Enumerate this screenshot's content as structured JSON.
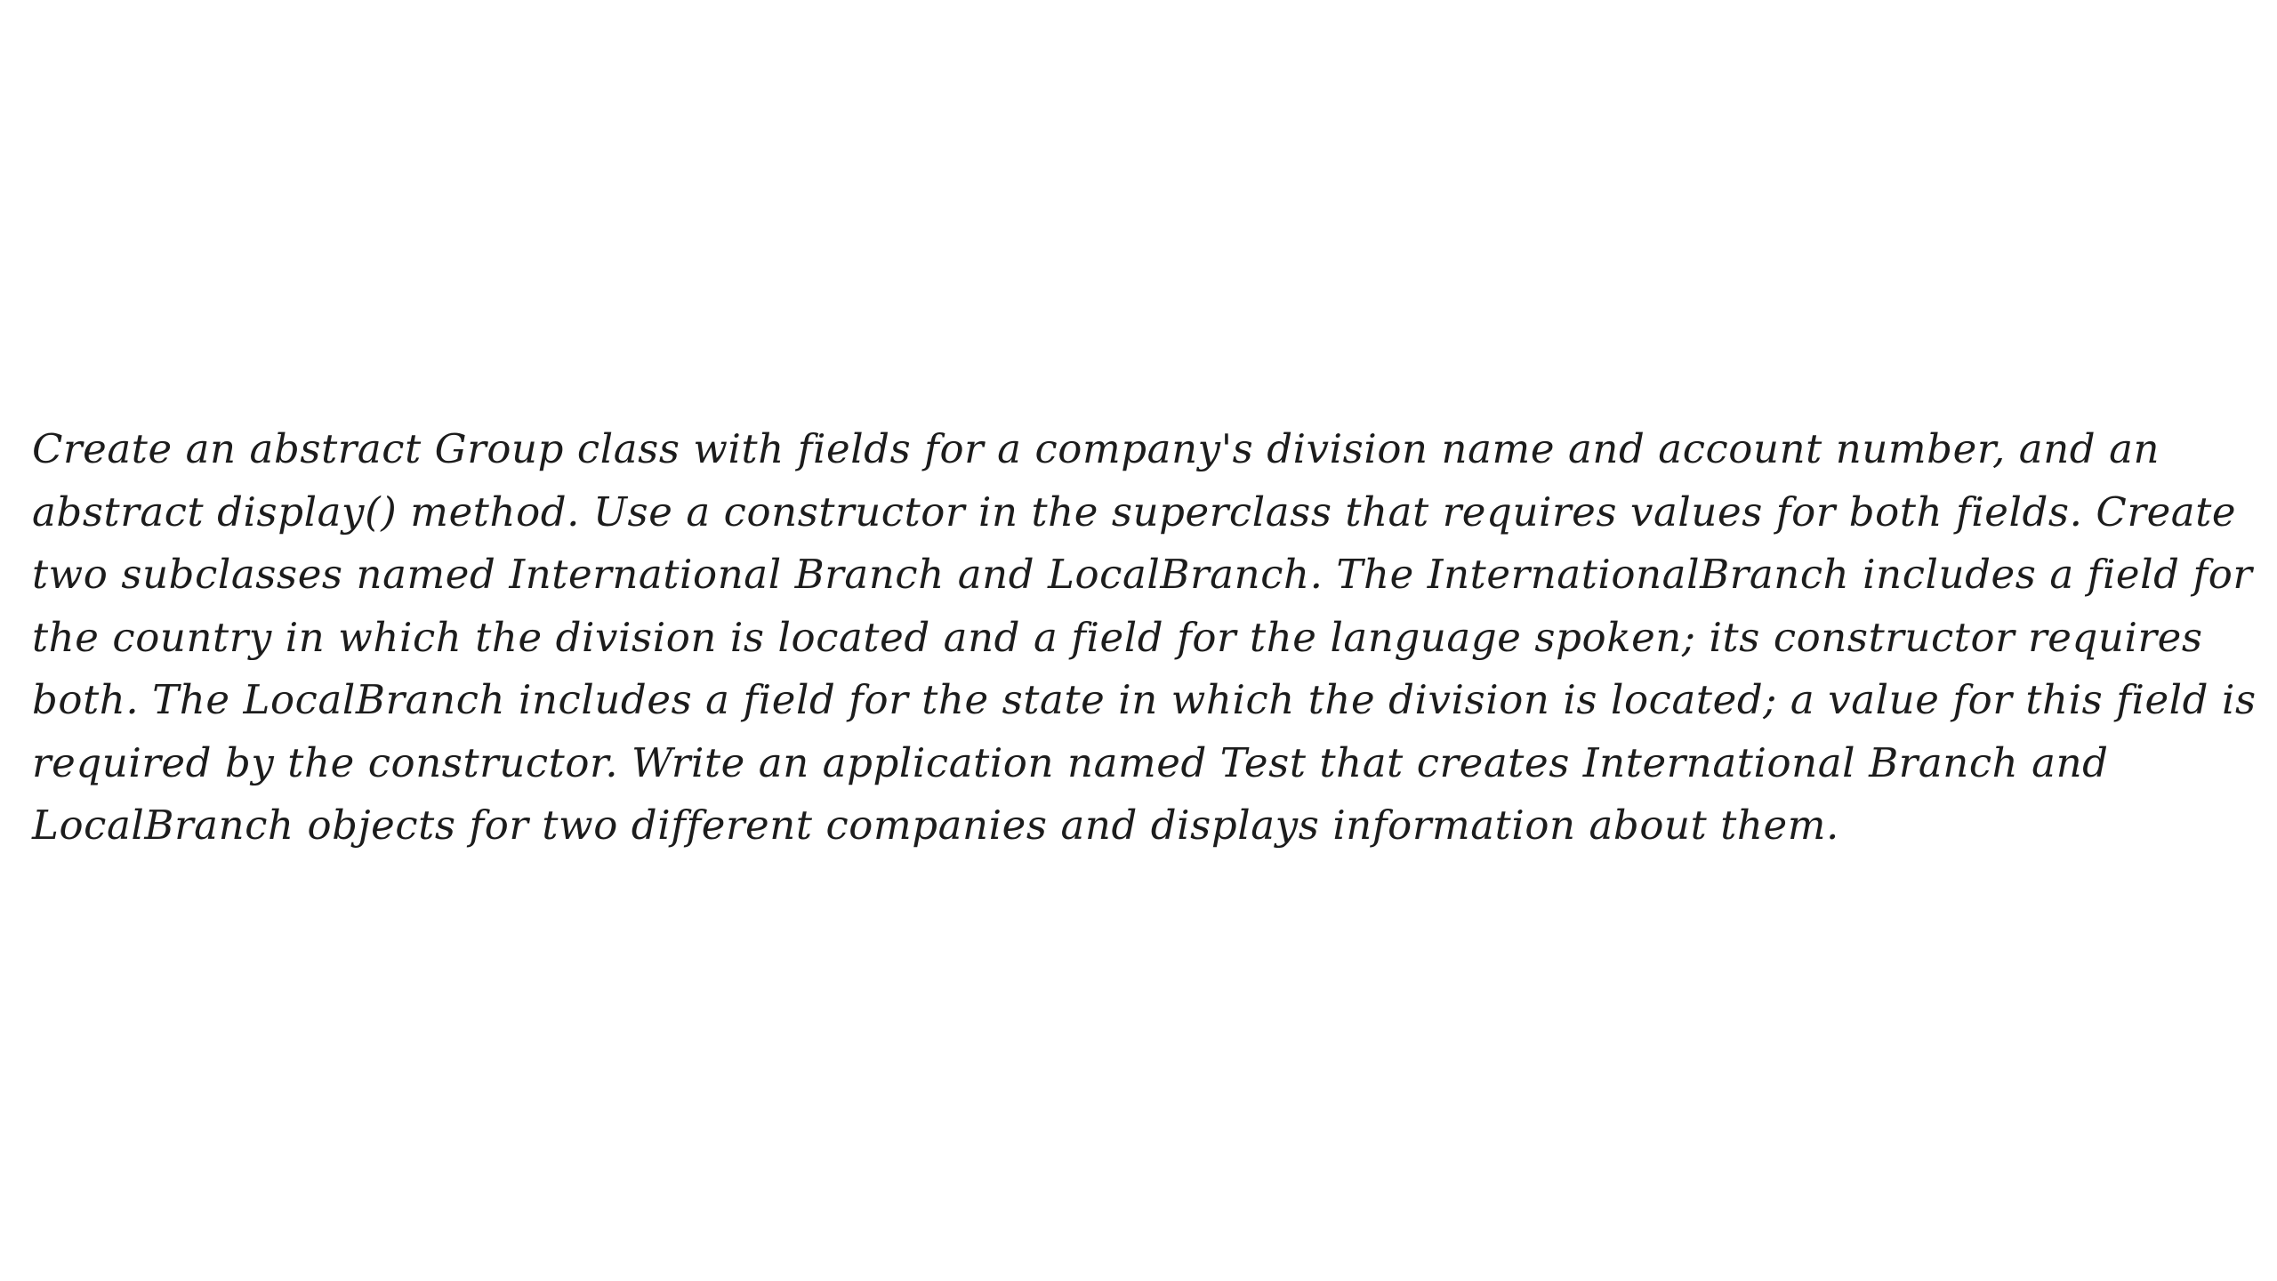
{
  "document": {
    "lines": [
      "Create an abstract Group class with fields for a company's division name and account number, and an",
      "abstract display() method. Use a constructor in the superclass that requires values for both fields. Create",
      "two subclasses named International Branch and LocalBranch. The InternationalBranch includes a field for",
      "the country in which the division is located and a field for the language spoken; its constructor requires",
      "both. The LocalBranch includes a field for the state in which the division is located; a value for this field is",
      "required by the constructor. Write an application named Test that creates International Branch and",
      "LocalBranch objects for two different companies and displays information about them."
    ]
  }
}
